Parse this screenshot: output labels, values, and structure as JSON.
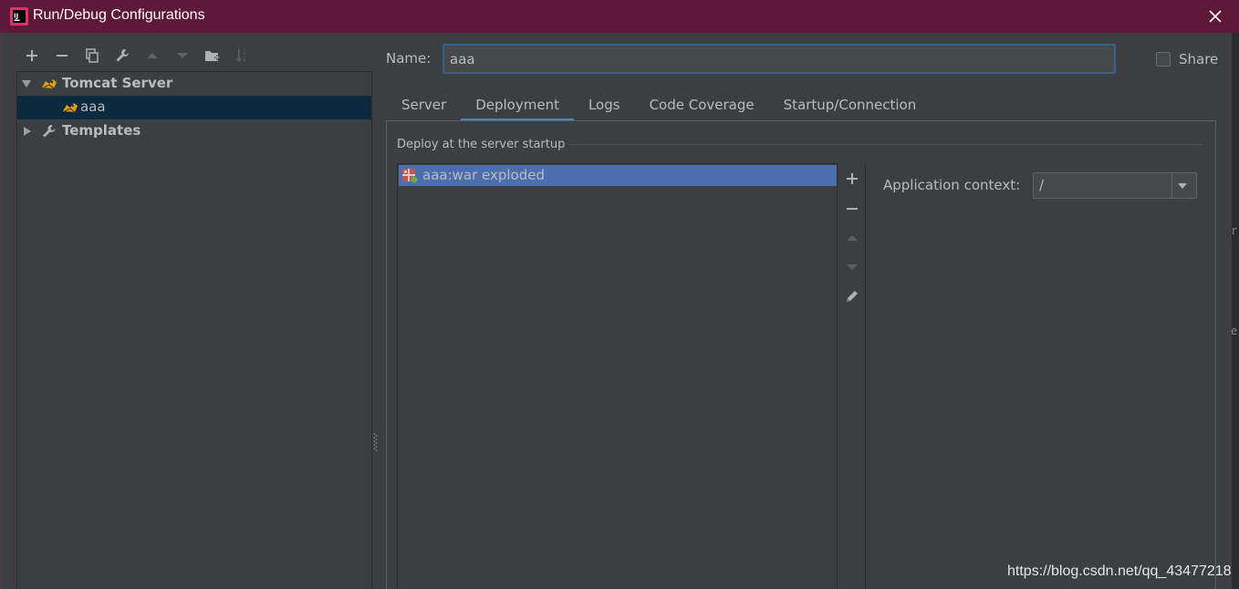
{
  "window": {
    "title": "Run/Debug Configurations",
    "app_icon": "intellij-idea-icon",
    "close_icon": "close-icon"
  },
  "left_toolbar": {
    "buttons": [
      {
        "icon": "add-icon",
        "enabled": true
      },
      {
        "icon": "remove-icon",
        "enabled": true
      },
      {
        "icon": "copy-icon",
        "enabled": true
      },
      {
        "icon": "wrench-icon",
        "enabled": true
      },
      {
        "icon": "arrow-up-icon",
        "enabled": false
      },
      {
        "icon": "arrow-down-icon",
        "enabled": false
      },
      {
        "icon": "new-folder-icon",
        "enabled": true
      },
      {
        "icon": "sort-icon",
        "enabled": false
      }
    ]
  },
  "tree": {
    "items": [
      {
        "label": "Tomcat Server",
        "expanded": true,
        "icon": "tomcat-icon"
      },
      {
        "label": "aaa",
        "selected": true,
        "icon": "tomcat-icon"
      },
      {
        "label": "Templates",
        "expanded": false,
        "icon": "wrench-icon"
      }
    ]
  },
  "form": {
    "name_label": "Name:",
    "name_value": "aaa",
    "share_label": "Share",
    "share_checked": false
  },
  "tabs": [
    {
      "label": "Server",
      "active": false
    },
    {
      "label": "Deployment",
      "active": true
    },
    {
      "label": "Logs",
      "active": false
    },
    {
      "label": "Code Coverage",
      "active": false
    },
    {
      "label": "Startup/Connection",
      "active": false
    }
  ],
  "deployment": {
    "group_title": "Deploy at the server startup",
    "artifacts": [
      {
        "label": "aaa:war exploded",
        "icon": "artifact-icon",
        "selected": true
      }
    ],
    "list_actions": [
      {
        "icon": "add-icon",
        "enabled": true
      },
      {
        "icon": "remove-icon",
        "enabled": true
      },
      {
        "icon": "arrow-up-icon",
        "enabled": false
      },
      {
        "icon": "arrow-down-icon",
        "enabled": false
      },
      {
        "icon": "edit-icon",
        "enabled": true
      }
    ],
    "context_label": "Application context:",
    "context_value": "/"
  },
  "watermark": "https://blog.csdn.net/qq_43477218",
  "colors": {
    "titlebar": "#5e1838",
    "panel": "#3c3f41",
    "selection_tree": "#0d293e",
    "selection_list": "#4b6eaf",
    "active_tab": "#4a88c7",
    "focus_border": "#3d6185"
  }
}
